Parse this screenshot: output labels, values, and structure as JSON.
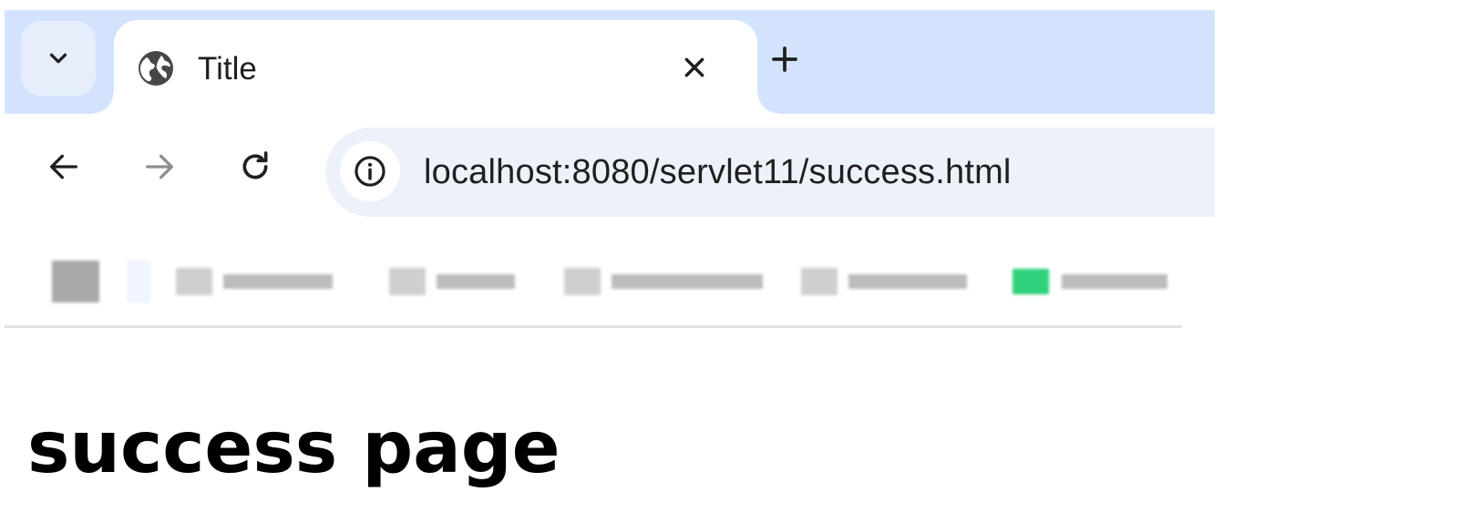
{
  "browser": {
    "tab": {
      "title": "Title",
      "favicon": "globe-icon",
      "close_icon": "close-icon"
    },
    "tab_search_icon": "chevron-down-icon",
    "new_tab_icon": "plus-icon",
    "toolbar": {
      "back_icon": "arrow-left-icon",
      "forward_icon": "arrow-right-icon",
      "reload_icon": "reload-icon",
      "site_info_icon": "info-icon",
      "url": "localhost:8080/servlet11/success.html"
    },
    "bookmarks_blurred": true
  },
  "page": {
    "heading": "success page"
  },
  "colors": {
    "tab_strip": "#d3e3fd",
    "omnibox": "#edf2fa",
    "icon": "#1f1f1f",
    "icon_disabled": "#8e8e8e",
    "bookmark_green": "#2fd17c"
  }
}
